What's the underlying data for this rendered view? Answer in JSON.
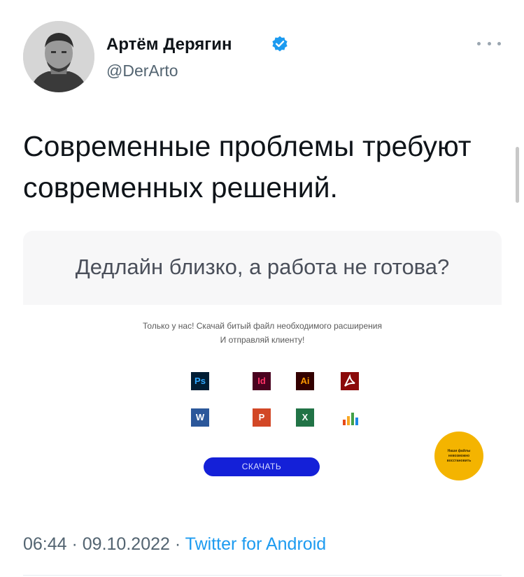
{
  "author": {
    "name": "Артём Дерягин",
    "handle": "@DerArto",
    "verified": true
  },
  "tweet": {
    "text": "Современные проблемы требуют современных решений.",
    "timestamp": "06:44 · 09.10.2022 · ",
    "source": "Twitter for Android"
  },
  "embed": {
    "title": "Дедлайн близко, а работа не готова?",
    "promo_line_1": "Только у нас! Скачай битый файл необходимого расширения",
    "promo_line_2": "И отправляй клиенту!",
    "apps": [
      {
        "label": "Ps",
        "icon": "photoshop-icon",
        "bg": "#001d34",
        "fg": "#31a8ff"
      },
      {
        "label": "Id",
        "icon": "indesign-icon",
        "bg": "#49021f",
        "fg": "#ff3366"
      },
      {
        "label": "Ai",
        "icon": "illustrator-icon",
        "bg": "#330000",
        "fg": "#ff9a00"
      },
      {
        "label": "",
        "icon": "acrobat-icon",
        "bg": "#8b0a0a",
        "fg": "#ffffff"
      },
      {
        "label": "W",
        "icon": "word-icon",
        "bg": "#2b579a",
        "fg": "#ffffff"
      },
      {
        "label": "P",
        "icon": "powerpoint-icon",
        "bg": "#d24726",
        "fg": "#ffffff"
      },
      {
        "label": "X",
        "icon": "excel-icon",
        "bg": "#217346",
        "fg": "#ffffff"
      },
      {
        "label": "",
        "icon": "chart-app-icon",
        "bg": "#ffffff",
        "fg": "#e64a19"
      }
    ],
    "download_label": "СКАЧАТЬ",
    "badge_text": "Наши файлы невозможно восстановить"
  },
  "colors": {
    "verified": "#1d9bf0",
    "link": "#1d9bf0",
    "secondary_text": "#536471",
    "button": "#1420d8",
    "badge": "#f4b400"
  }
}
